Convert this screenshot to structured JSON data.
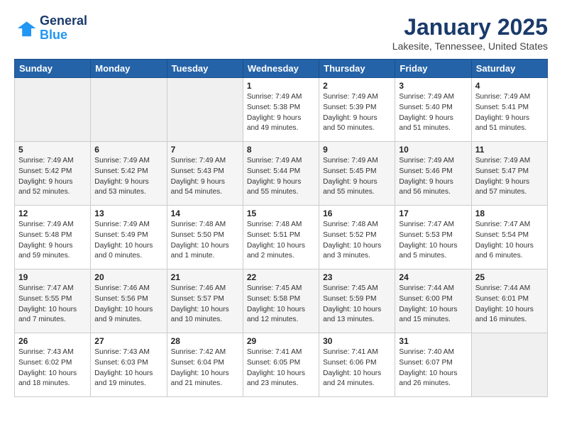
{
  "logo": {
    "line1": "General",
    "line2": "Blue"
  },
  "title": "January 2025",
  "subtitle": "Lakesite, Tennessee, United States",
  "headers": [
    "Sunday",
    "Monday",
    "Tuesday",
    "Wednesday",
    "Thursday",
    "Friday",
    "Saturday"
  ],
  "weeks": [
    [
      {
        "date": "",
        "info": "",
        "empty": true
      },
      {
        "date": "",
        "info": "",
        "empty": true
      },
      {
        "date": "",
        "info": "",
        "empty": true
      },
      {
        "date": "1",
        "info": "Sunrise: 7:49 AM\nSunset: 5:38 PM\nDaylight: 9 hours\nand 49 minutes."
      },
      {
        "date": "2",
        "info": "Sunrise: 7:49 AM\nSunset: 5:39 PM\nDaylight: 9 hours\nand 50 minutes."
      },
      {
        "date": "3",
        "info": "Sunrise: 7:49 AM\nSunset: 5:40 PM\nDaylight: 9 hours\nand 51 minutes."
      },
      {
        "date": "4",
        "info": "Sunrise: 7:49 AM\nSunset: 5:41 PM\nDaylight: 9 hours\nand 51 minutes."
      }
    ],
    [
      {
        "date": "5",
        "info": "Sunrise: 7:49 AM\nSunset: 5:42 PM\nDaylight: 9 hours\nand 52 minutes.",
        "shaded": true
      },
      {
        "date": "6",
        "info": "Sunrise: 7:49 AM\nSunset: 5:42 PM\nDaylight: 9 hours\nand 53 minutes.",
        "shaded": true
      },
      {
        "date": "7",
        "info": "Sunrise: 7:49 AM\nSunset: 5:43 PM\nDaylight: 9 hours\nand 54 minutes.",
        "shaded": true
      },
      {
        "date": "8",
        "info": "Sunrise: 7:49 AM\nSunset: 5:44 PM\nDaylight: 9 hours\nand 55 minutes.",
        "shaded": true
      },
      {
        "date": "9",
        "info": "Sunrise: 7:49 AM\nSunset: 5:45 PM\nDaylight: 9 hours\nand 55 minutes.",
        "shaded": true
      },
      {
        "date": "10",
        "info": "Sunrise: 7:49 AM\nSunset: 5:46 PM\nDaylight: 9 hours\nand 56 minutes.",
        "shaded": true
      },
      {
        "date": "11",
        "info": "Sunrise: 7:49 AM\nSunset: 5:47 PM\nDaylight: 9 hours\nand 57 minutes.",
        "shaded": true
      }
    ],
    [
      {
        "date": "12",
        "info": "Sunrise: 7:49 AM\nSunset: 5:48 PM\nDaylight: 9 hours\nand 59 minutes."
      },
      {
        "date": "13",
        "info": "Sunrise: 7:49 AM\nSunset: 5:49 PM\nDaylight: 10 hours\nand 0 minutes."
      },
      {
        "date": "14",
        "info": "Sunrise: 7:48 AM\nSunset: 5:50 PM\nDaylight: 10 hours\nand 1 minute."
      },
      {
        "date": "15",
        "info": "Sunrise: 7:48 AM\nSunset: 5:51 PM\nDaylight: 10 hours\nand 2 minutes."
      },
      {
        "date": "16",
        "info": "Sunrise: 7:48 AM\nSunset: 5:52 PM\nDaylight: 10 hours\nand 3 minutes."
      },
      {
        "date": "17",
        "info": "Sunrise: 7:47 AM\nSunset: 5:53 PM\nDaylight: 10 hours\nand 5 minutes."
      },
      {
        "date": "18",
        "info": "Sunrise: 7:47 AM\nSunset: 5:54 PM\nDaylight: 10 hours\nand 6 minutes."
      }
    ],
    [
      {
        "date": "19",
        "info": "Sunrise: 7:47 AM\nSunset: 5:55 PM\nDaylight: 10 hours\nand 7 minutes.",
        "shaded": true
      },
      {
        "date": "20",
        "info": "Sunrise: 7:46 AM\nSunset: 5:56 PM\nDaylight: 10 hours\nand 9 minutes.",
        "shaded": true
      },
      {
        "date": "21",
        "info": "Sunrise: 7:46 AM\nSunset: 5:57 PM\nDaylight: 10 hours\nand 10 minutes.",
        "shaded": true
      },
      {
        "date": "22",
        "info": "Sunrise: 7:45 AM\nSunset: 5:58 PM\nDaylight: 10 hours\nand 12 minutes.",
        "shaded": true
      },
      {
        "date": "23",
        "info": "Sunrise: 7:45 AM\nSunset: 5:59 PM\nDaylight: 10 hours\nand 13 minutes.",
        "shaded": true
      },
      {
        "date": "24",
        "info": "Sunrise: 7:44 AM\nSunset: 6:00 PM\nDaylight: 10 hours\nand 15 minutes.",
        "shaded": true
      },
      {
        "date": "25",
        "info": "Sunrise: 7:44 AM\nSunset: 6:01 PM\nDaylight: 10 hours\nand 16 minutes.",
        "shaded": true
      }
    ],
    [
      {
        "date": "26",
        "info": "Sunrise: 7:43 AM\nSunset: 6:02 PM\nDaylight: 10 hours\nand 18 minutes."
      },
      {
        "date": "27",
        "info": "Sunrise: 7:43 AM\nSunset: 6:03 PM\nDaylight: 10 hours\nand 19 minutes."
      },
      {
        "date": "28",
        "info": "Sunrise: 7:42 AM\nSunset: 6:04 PM\nDaylight: 10 hours\nand 21 minutes."
      },
      {
        "date": "29",
        "info": "Sunrise: 7:41 AM\nSunset: 6:05 PM\nDaylight: 10 hours\nand 23 minutes."
      },
      {
        "date": "30",
        "info": "Sunrise: 7:41 AM\nSunset: 6:06 PM\nDaylight: 10 hours\nand 24 minutes."
      },
      {
        "date": "31",
        "info": "Sunrise: 7:40 AM\nSunset: 6:07 PM\nDaylight: 10 hours\nand 26 minutes."
      },
      {
        "date": "",
        "info": "",
        "empty": true
      }
    ]
  ]
}
